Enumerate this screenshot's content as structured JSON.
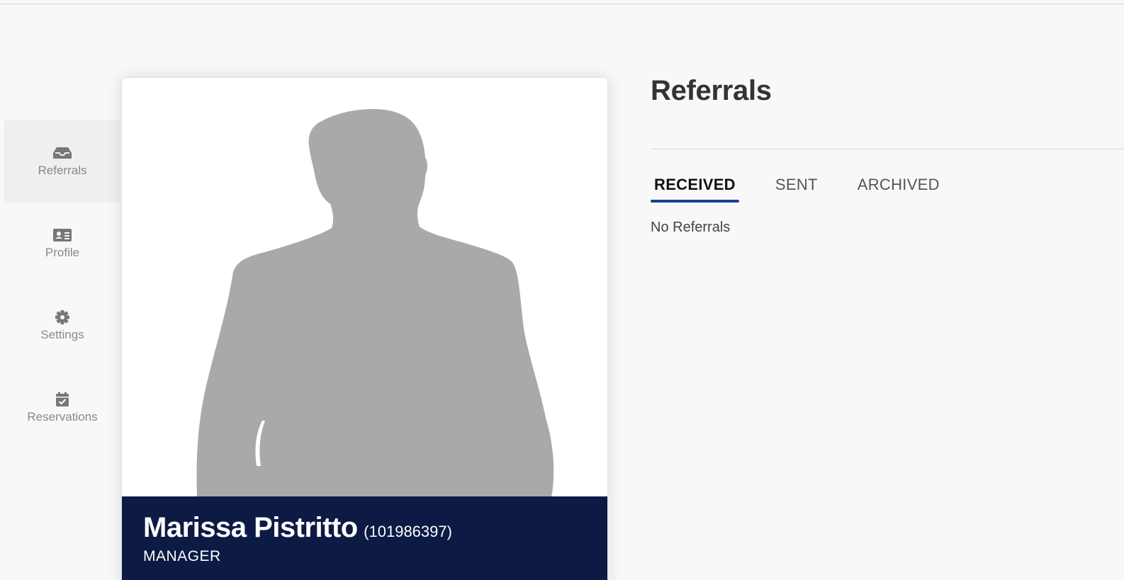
{
  "sidebar": {
    "items": [
      {
        "label": "Referrals",
        "icon": "inbox-icon",
        "active": true
      },
      {
        "label": "Profile",
        "icon": "id-card-icon",
        "active": false
      },
      {
        "label": "Settings",
        "icon": "gear-icon",
        "active": false
      },
      {
        "label": "Reservations",
        "icon": "calendar-check-icon",
        "active": false
      }
    ]
  },
  "profile": {
    "name": "Marissa Pistritto",
    "id": "(101986397)",
    "role": "MANAGER"
  },
  "main": {
    "title": "Referrals",
    "tabs": [
      {
        "label": "RECEIVED",
        "active": true
      },
      {
        "label": "SENT",
        "active": false
      },
      {
        "label": "ARCHIVED",
        "active": false
      }
    ],
    "empty_message": "No Referrals"
  },
  "colors": {
    "name_bar": "#0c1a44",
    "tab_underline": "#1a3f99",
    "avatar_silhouette": "#a9a9a9"
  }
}
